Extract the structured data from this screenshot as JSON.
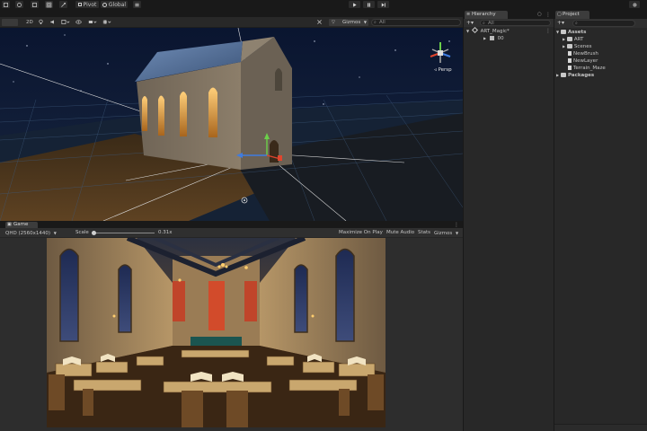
{
  "toolbar": {
    "pivot_label": "Pivot",
    "global_label": "Global",
    "play_icon": "play-icon",
    "pause_icon": "pause-icon",
    "step_icon": "step-icon"
  },
  "scene": {
    "mode_2d": "2D",
    "gizmos_label": "Gizmos",
    "search_placeholder": "All",
    "persp_label": "Persp"
  },
  "game": {
    "tab_label": "Game",
    "resolution": "QHD (2560x1440)",
    "scale_label": "Scale",
    "scale_value": "0.31x",
    "maximize": "Maximize On Play",
    "mute": "Mute Audio",
    "stats": "Stats",
    "gizmos": "Gizmos"
  },
  "hierarchy": {
    "tab_label": "Hierarchy",
    "search_placeholder": "All",
    "items": [
      {
        "label": "ART_Magic*",
        "depth": 0
      },
      {
        "label": "00",
        "depth": 1
      }
    ]
  },
  "project": {
    "tab_label": "Project",
    "tree": [
      {
        "label": "Assets",
        "depth": 0,
        "type": "folder",
        "bold": true
      },
      {
        "label": "ART",
        "depth": 1,
        "type": "folder"
      },
      {
        "label": "Scenes",
        "depth": 1,
        "type": "folder"
      },
      {
        "label": "NewBrush",
        "depth": 1,
        "type": "file"
      },
      {
        "label": "NewLayer",
        "depth": 1,
        "type": "file"
      },
      {
        "label": "Terrain_Maze",
        "depth": 1,
        "type": "file"
      },
      {
        "label": "Packages",
        "depth": 0,
        "type": "folder",
        "bold": true
      }
    ]
  },
  "colors": {
    "accent": "#4a90e2",
    "panel": "#282828",
    "background": "#191919"
  }
}
